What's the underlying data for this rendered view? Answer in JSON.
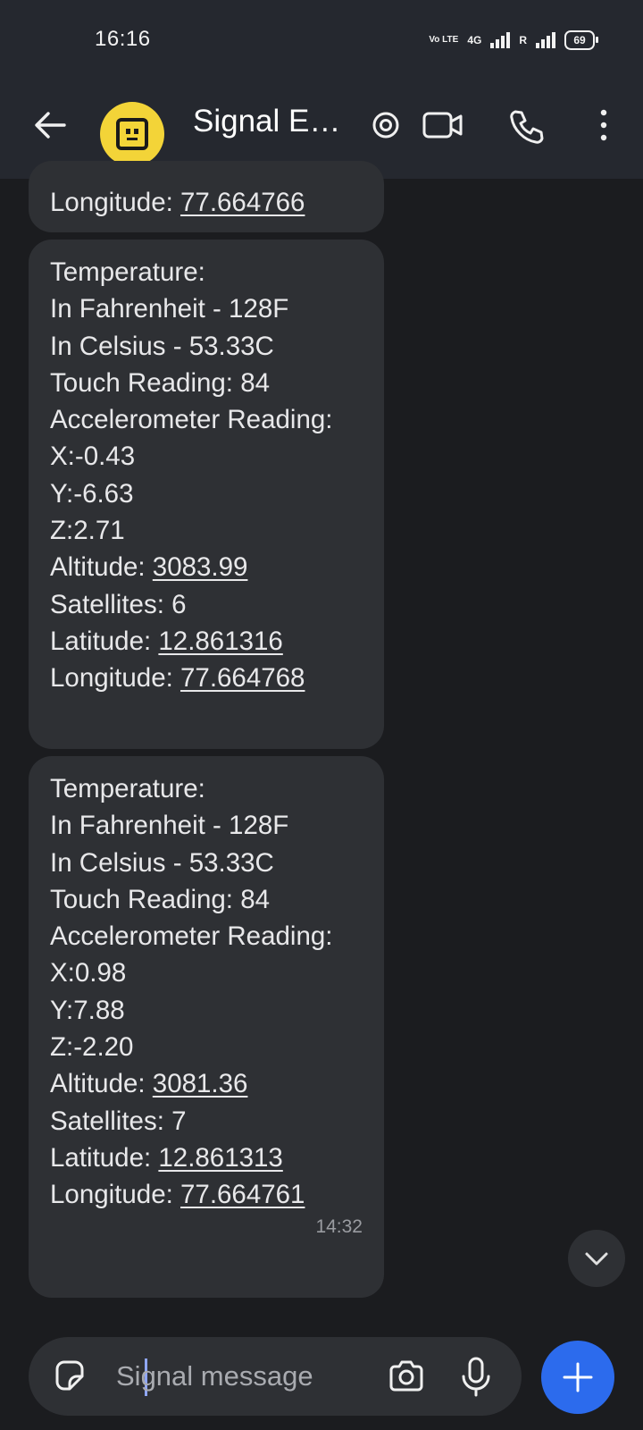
{
  "status_bar": {
    "time": "16:16",
    "volte": "Vo LTE",
    "network_1": "4G",
    "network_2": "R",
    "battery": "69"
  },
  "header": {
    "title": "Signal E…"
  },
  "messages": [
    {
      "lines": [
        {
          "label": "Longitude: ",
          "value": "77.664766"
        }
      ]
    },
    {
      "lines": [
        {
          "label": "Temperature:"
        },
        {
          "label": "In Fahrenheit - 128F"
        },
        {
          "label": "In Celsius - 53.33C"
        },
        {
          "label": "Touch Reading: 84"
        },
        {
          "label": "Accelerometer Reading:"
        },
        {
          "label": "X:-0.43"
        },
        {
          "label": "Y:-6.63"
        },
        {
          "label": "Z:2.71"
        },
        {
          "label": ""
        },
        {
          "label": "Altitude: ",
          "value": "3083.99"
        },
        {
          "label": "Satellites: 6"
        },
        {
          "label": "Latitude: ",
          "value": "12.861316"
        },
        {
          "label": "Longitude: ",
          "value": "77.664768"
        }
      ]
    },
    {
      "lines": [
        {
          "label": "Temperature:"
        },
        {
          "label": "In Fahrenheit - 128F"
        },
        {
          "label": "In Celsius - 53.33C"
        },
        {
          "label": "Touch Reading: 84"
        },
        {
          "label": "Accelerometer Reading:"
        },
        {
          "label": "X:0.98"
        },
        {
          "label": "Y:7.88"
        },
        {
          "label": "Z:-2.20"
        },
        {
          "label": ""
        },
        {
          "label": "Altitude: ",
          "value": "3081.36"
        },
        {
          "label": "Satellites: 7"
        },
        {
          "label": "Latitude: ",
          "value": "12.861313"
        },
        {
          "label": "Longitude: ",
          "value": "77.664761"
        }
      ],
      "time": "14:32"
    }
  ],
  "composer": {
    "placeholder": "Signal message"
  },
  "icons": {
    "back": "arrow-left-icon",
    "avatar": "robot-face-icon",
    "mention": "at-sign-icon",
    "video": "video-camera-icon",
    "call": "phone-icon",
    "menu": "more-vertical-icon",
    "scroll": "chevron-down-icon",
    "sticker": "sticker-icon",
    "camera": "camera-icon",
    "mic": "microphone-icon",
    "attach": "plus-icon"
  },
  "colors": {
    "accent": "#2c6bed",
    "avatar": "#f3d438",
    "bubble": "#2e3034",
    "background": "#1b1c1f",
    "header": "#25282f"
  }
}
